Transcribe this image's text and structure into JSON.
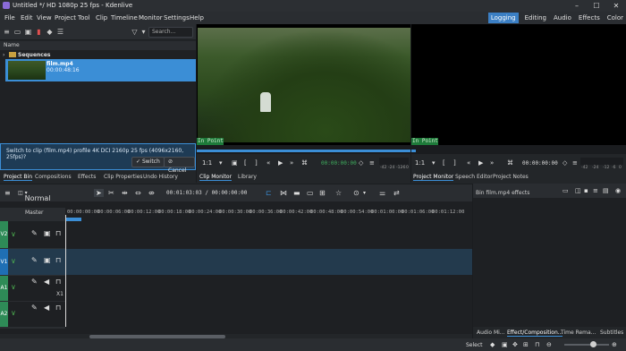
{
  "window": {
    "title": "Untitled */ HD 1080p 25 fps - Kdenlive",
    "controls": [
      "–",
      "☐",
      "✕"
    ]
  },
  "menu": [
    "File",
    "Edit",
    "View",
    "Project",
    "Tool",
    "Clip",
    "Timeline",
    "Monitor",
    "Settings",
    "Help"
  ],
  "layouts": [
    "Logging",
    "Editing",
    "Audio",
    "Effects",
    "Color"
  ],
  "layout_active": "Logging",
  "bin": {
    "search_placeholder": "Search...",
    "column_name": "Name",
    "sequences_label": "Sequences",
    "clip": {
      "name": "film.mp4",
      "duration": "00:00:48:16"
    }
  },
  "profile_prompt": {
    "text": "Switch to clip (film.mp4) profile 4K DCI 2160p 25 fps (4096x2160, 25fps)?",
    "switch_label": "Switch",
    "cancel_label": "Cancel"
  },
  "left_tabs": [
    "Project Bin",
    "Compositions",
    "Effects",
    "Clip Properties",
    "Undo History"
  ],
  "clip_monitor": {
    "in_point": "In Point",
    "zoom": "1:1",
    "timecode": "00:00:00:00",
    "audio_meter": [
      "-42",
      "-24",
      "-12",
      "-6",
      "0"
    ]
  },
  "project_monitor": {
    "in_point": "In Point",
    "zoom": "1:1",
    "timecode": "00:00:00:00",
    "audio_meter": [
      "-42",
      "-24",
      "-12",
      "-6",
      "0"
    ]
  },
  "mid_tabs": [
    "Clip Monitor",
    "Library"
  ],
  "right_tabs": [
    "Project Monitor",
    "Speech Editor",
    "Project Notes"
  ],
  "timeline": {
    "mode": "Normal Mode",
    "timecode": "00:01:03:03 / 00:00:00:00",
    "master_label": "Master",
    "ruler": [
      "00:00:00:00",
      "00:00:06:00",
      "00:00:12:00",
      "00:00:18:00",
      "00:00:24:00",
      "00:00:30:00",
      "00:00:36:00",
      "00:00:42:00",
      "00:00:48:00",
      "00:00:54:00",
      "00:01:00:00",
      "00:01:06:00",
      "00:01:12:00"
    ],
    "tracks": [
      "V2",
      "V1",
      "A1",
      "A2"
    ],
    "track_colors": [
      "#2e8b57",
      "#1f6fb4",
      "#2e8b57",
      "#2e8b57"
    ],
    "speed_label": "X1"
  },
  "effect_stack": {
    "title": "Bin film.mp4 effects"
  },
  "bottom_tabs": [
    "Audio Mi...",
    "Effect/Composition...",
    "Time Rema...",
    "Subtitles"
  ],
  "status": {
    "select_label": "Select"
  }
}
